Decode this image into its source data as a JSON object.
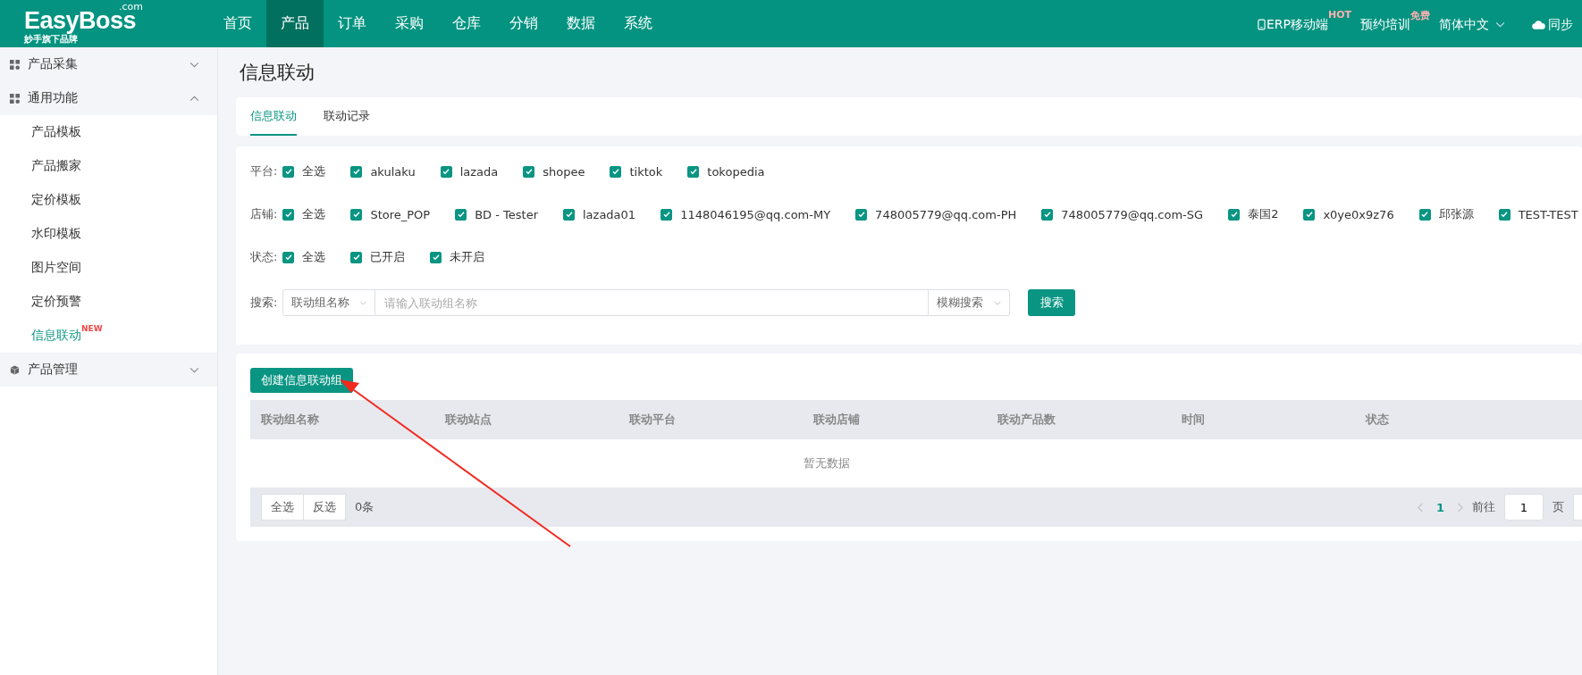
{
  "header": {
    "logo": "EasyBoss",
    "logo_suffix": ".com",
    "logo_tagline": "妙手旗下品牌",
    "nav": [
      {
        "label": "首页",
        "selected": false
      },
      {
        "label": "产品",
        "selected": true
      },
      {
        "label": "订单",
        "selected": false
      },
      {
        "label": "采购",
        "selected": false
      },
      {
        "label": "仓库",
        "selected": false
      },
      {
        "label": "分销",
        "selected": false
      },
      {
        "label": "数据",
        "selected": false
      },
      {
        "label": "系统",
        "selected": false
      }
    ],
    "mobile": {
      "label": "ERP移动端",
      "badge": "HOT"
    },
    "training": {
      "label": "预约培训",
      "badge": "免费"
    },
    "language": "简体中文",
    "sync": "同步"
  },
  "sidebar": [
    {
      "label": "产品采集",
      "expanded": false
    },
    {
      "label": "通用功能",
      "expanded": true,
      "children": [
        {
          "label": "产品模板",
          "selected": false
        },
        {
          "label": "产品搬家",
          "selected": false
        },
        {
          "label": "定价模板",
          "selected": false
        },
        {
          "label": "水印模板",
          "selected": false
        },
        {
          "label": "图片空间",
          "selected": false
        },
        {
          "label": "定价预警",
          "selected": false
        },
        {
          "label": "信息联动",
          "selected": true,
          "badge": "NEW"
        }
      ]
    },
    {
      "label": "产品管理",
      "expanded": false
    }
  ],
  "page_title": "信息联动",
  "tabs": [
    {
      "label": "信息联动",
      "selected": true
    },
    {
      "label": "联动记录",
      "selected": false
    }
  ],
  "filters": [
    {
      "label": "平台:",
      "options": [
        {
          "label": "全选",
          "checked": true
        },
        {
          "label": "akulaku",
          "checked": true
        },
        {
          "label": "lazada",
          "checked": true
        },
        {
          "label": "shopee",
          "checked": true
        },
        {
          "label": "tiktok",
          "checked": true
        },
        {
          "label": "tokopedia",
          "checked": true
        }
      ]
    },
    {
      "label": "店铺:",
      "options": [
        {
          "label": "全选",
          "checked": true
        },
        {
          "label": "Store_POP",
          "checked": true
        },
        {
          "label": "BD - Tester",
          "checked": true
        },
        {
          "label": "lazada01",
          "checked": true
        },
        {
          "label": "1148046195@qq.com-MY",
          "checked": true
        },
        {
          "label": "748005779@qq.com-PH",
          "checked": true
        },
        {
          "label": "748005779@qq.com-SG",
          "checked": true
        },
        {
          "label": "泰国2",
          "checked": true
        },
        {
          "label": "x0ye0x9z76",
          "checked": true
        },
        {
          "label": "邱张源",
          "checked": true
        },
        {
          "label": "TEST-TEST",
          "checked": true
        }
      ]
    },
    {
      "label": "状态:",
      "options": [
        {
          "label": "全选",
          "checked": true
        },
        {
          "label": "已开启",
          "checked": true
        },
        {
          "label": "未开启",
          "checked": true
        }
      ]
    }
  ],
  "search": {
    "label": "搜索:",
    "field_type": "联动组名称",
    "placeholder": "请输入联动组名称",
    "mode": "模糊搜索",
    "button": "搜索"
  },
  "create_button": "创建信息联动组",
  "table": {
    "columns": [
      "联动组名称",
      "联动站点",
      "联动平台",
      "联动店铺",
      "联动产品数",
      "时间",
      "状态"
    ],
    "empty_text": "暂无数据"
  },
  "footer": {
    "select_all": "全选",
    "invert": "反选",
    "count": "0条"
  },
  "pagination": {
    "current": "1",
    "goto_label": "前往",
    "goto_value": "1",
    "page_suffix": "页"
  }
}
